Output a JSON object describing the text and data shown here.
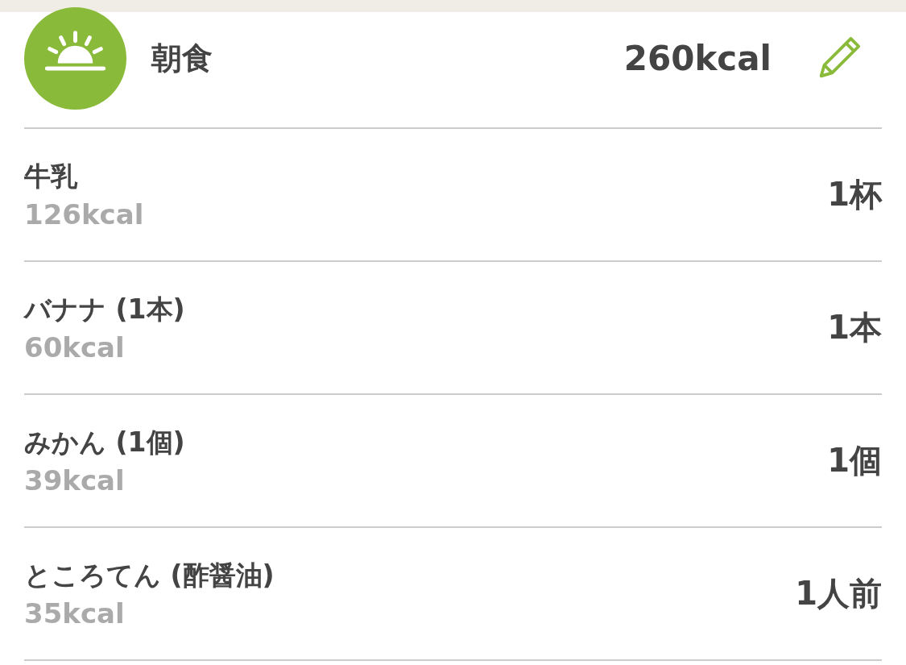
{
  "meal": {
    "title": "朝食",
    "total": "260kcal"
  },
  "items": [
    {
      "name": "牛乳",
      "kcal": "126kcal",
      "quantity": "1杯"
    },
    {
      "name": "バナナ (1本)",
      "kcal": "60kcal",
      "quantity": "1本"
    },
    {
      "name": "みかん (1個)",
      "kcal": "39kcal",
      "quantity": "1個"
    },
    {
      "name": "ところてん (酢醤油)",
      "kcal": "35kcal",
      "quantity": "1人前"
    }
  ]
}
